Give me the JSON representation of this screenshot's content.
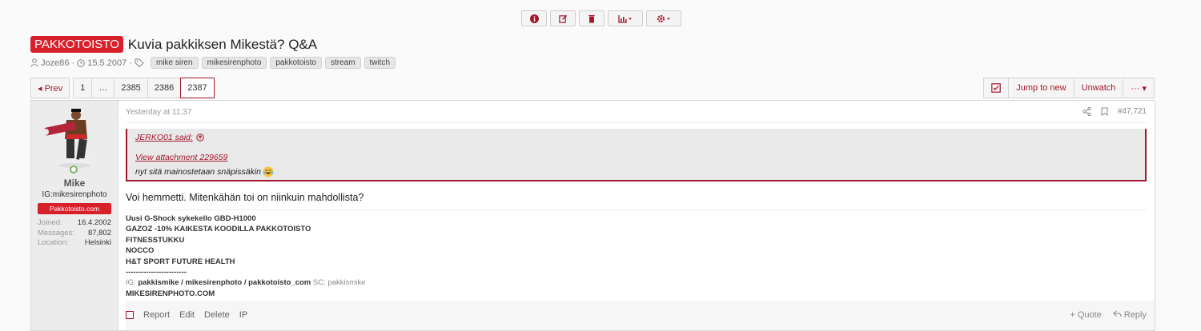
{
  "thread": {
    "prefix": "PAKKOTOISTO",
    "title": "Kuvia pakkiksen Mikestä? Q&A",
    "author": "Joze86",
    "start_date": "15.5.2007",
    "tags": [
      "mike siren",
      "mikesirenphoto",
      "pakkotoisto",
      "stream",
      "twitch"
    ]
  },
  "pager": {
    "prev_label": "◂ Prev",
    "pages": [
      "1",
      "…",
      "2385",
      "2386",
      "2387"
    ],
    "current": "2387"
  },
  "actions": {
    "jump_label": "Jump to new",
    "unwatch_label": "Unwatch",
    "more_label": "··· ▾"
  },
  "post": {
    "date": "Yesterday at 11:37",
    "number": "#47,721",
    "user": {
      "name": "Mike",
      "title": "IG:mikesirenphoto",
      "banner": "Pakkotoisto.com",
      "stats": [
        {
          "k": "Joined:",
          "v": "16.4.2002"
        },
        {
          "k": "Messages:",
          "v": "87,802"
        },
        {
          "k": "Location:",
          "v": "Helsinki"
        }
      ]
    },
    "quote": {
      "author": "JERKO01 said:",
      "attachment": "View attachment 229659",
      "text": "nyt sitä mainostetaan snäpissäkin"
    },
    "body": "Voi hemmetti. Mitenkähän toi on niinkuin mahdollista?",
    "signature": {
      "l1": "Uusi G-Shock sykekello GBD-H1000",
      "l2": "GAZOZ -10% KAIKESTA KOODILLA PAKKOTOISTO",
      "l3": "FITNESSTUKKU",
      "l4": "NOCCO",
      "l5": "H&T SPORT FUTURE HEALTH",
      "l6": "------------------------",
      "ig_label": "IG: ",
      "ig": "pakkismike / mikesirenphoto / pakkotoisto_com",
      "sc_label": " SC: ",
      "sc": "pakkismike",
      "l8": "MIKESIRENPHOTO.COM"
    },
    "footer": {
      "report": "Report",
      "edit": "Edit",
      "delete": "Delete",
      "ip": "IP",
      "quote": "+ Quote",
      "reply": "Reply"
    }
  },
  "colors": {
    "accent": "#a2182b",
    "prefix_bg": "#d8202b"
  }
}
